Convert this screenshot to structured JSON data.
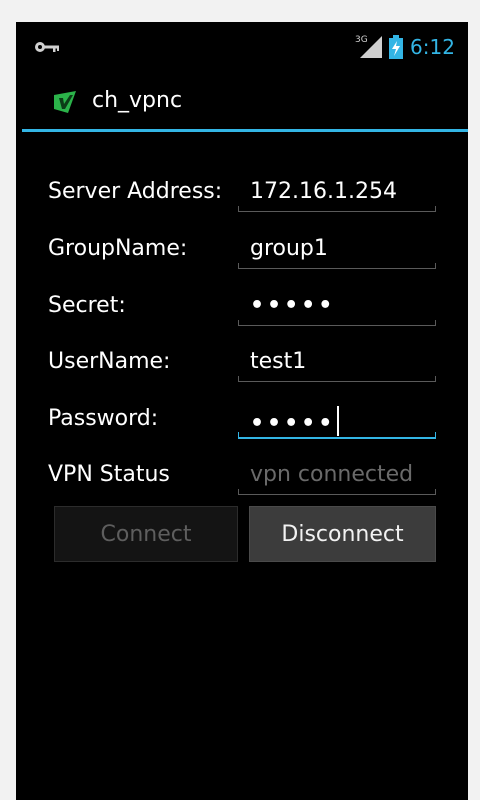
{
  "status_bar": {
    "network_label": "3G",
    "time": "6:12",
    "icons": [
      "key-icon",
      "signal-icon",
      "battery-charging-icon"
    ]
  },
  "action_bar": {
    "title": "ch_vpnc",
    "icon": "app-icon"
  },
  "form": {
    "server_address": {
      "label": "Server Address:",
      "value": "172.16.1.254"
    },
    "group_name": {
      "label": "GroupName:",
      "value": "group1"
    },
    "secret": {
      "label": "Secret:",
      "value": "•••••"
    },
    "user_name": {
      "label": "UserName:",
      "value": "test1"
    },
    "password": {
      "label": "Password:",
      "value": "•••••"
    },
    "vpn_status": {
      "label": "VPN Status",
      "placeholder": "vpn connected"
    }
  },
  "buttons": {
    "connect": "Connect",
    "disconnect": "Disconnect"
  },
  "colors": {
    "accent": "#33b5e5",
    "app_icon": "#2bb34a",
    "background": "#000000"
  }
}
